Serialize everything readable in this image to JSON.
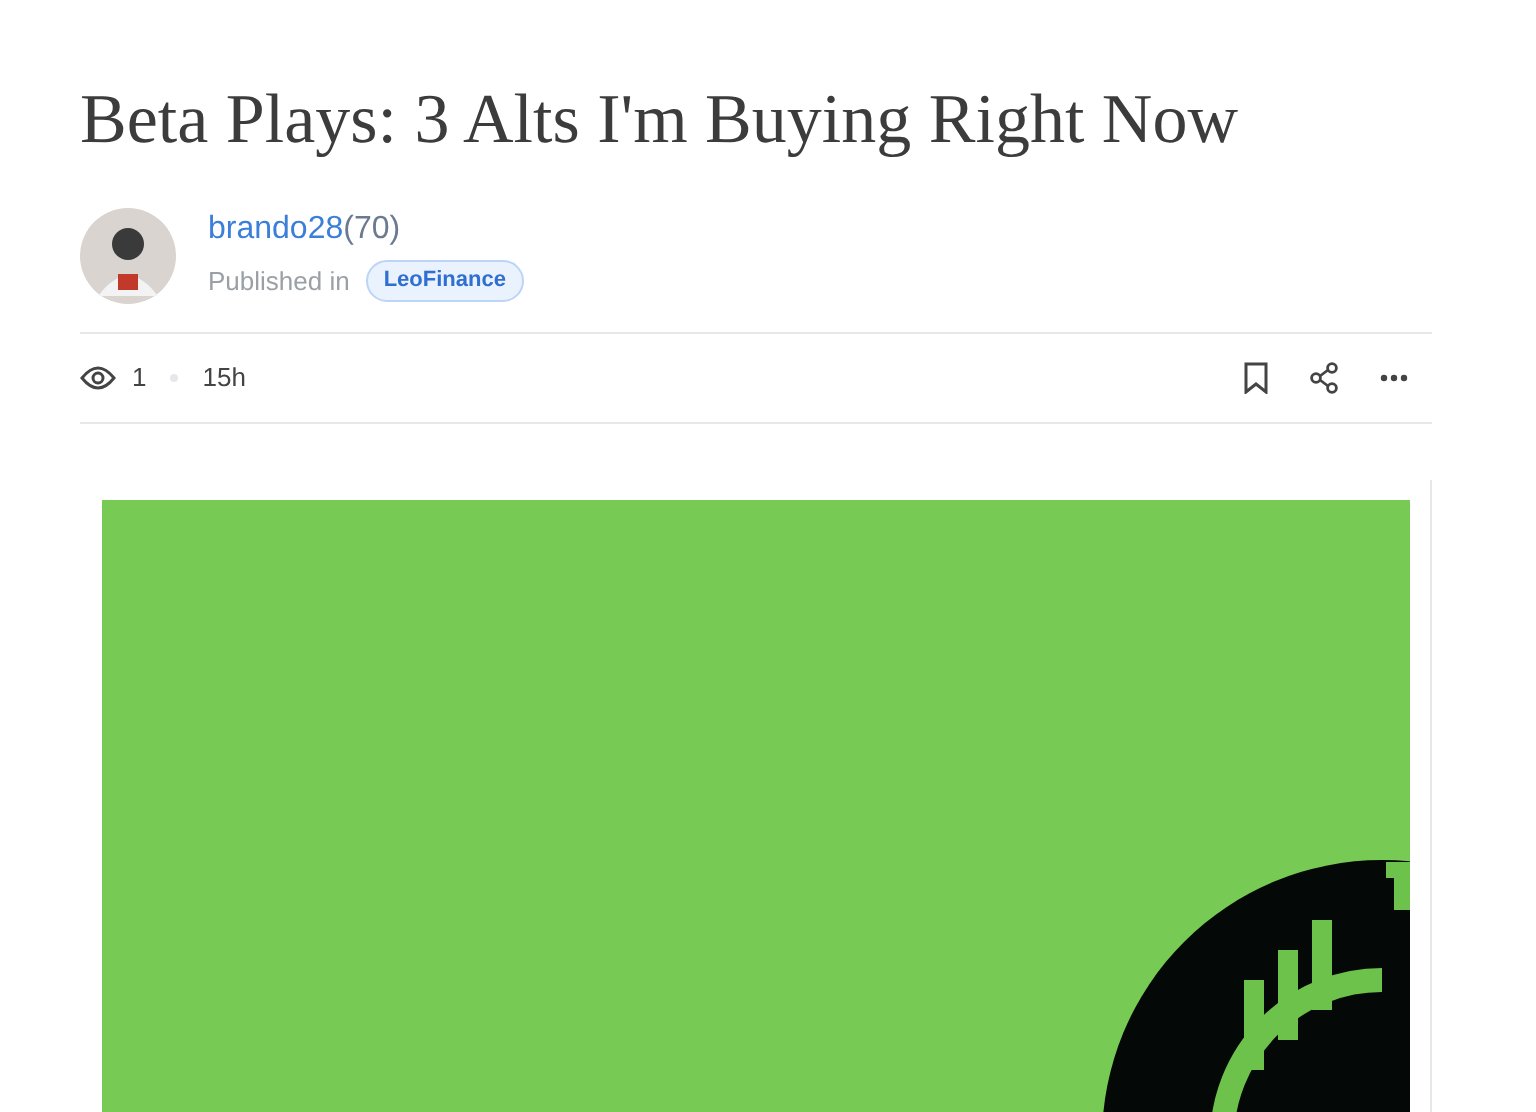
{
  "title": "Beta Plays: 3 Alts I'm Buying Right Now",
  "author": {
    "name": "brando28",
    "reputation": "(70)",
    "published_label": "Published in",
    "community": "LeoFinance"
  },
  "stats": {
    "views": "1",
    "age": "15h"
  }
}
